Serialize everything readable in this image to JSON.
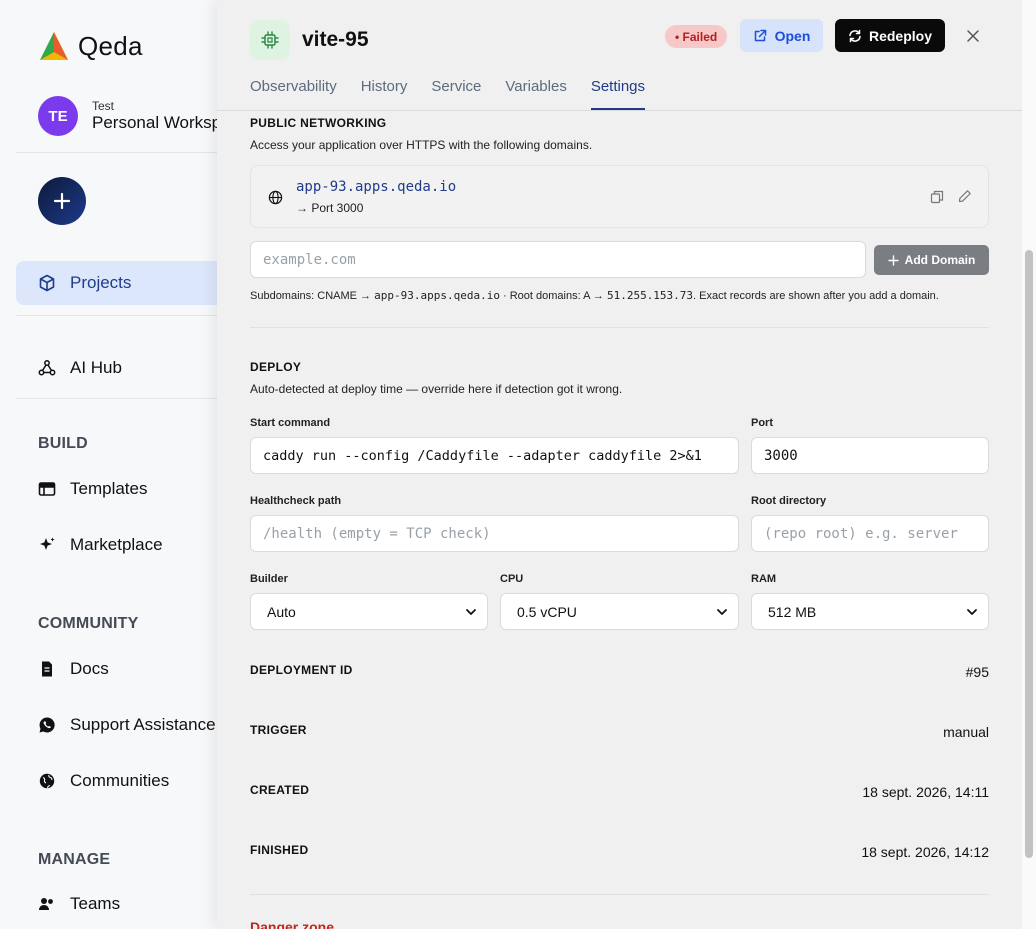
{
  "sidebar": {
    "brand": "Qeda",
    "workspace": {
      "initials": "TE",
      "label": "Test",
      "name": "Personal Workspace"
    },
    "items": {
      "projects": "Projects",
      "ai_hub": "AI Hub",
      "templates": "Templates",
      "marketplace": "Marketplace",
      "docs": "Docs",
      "support": "Support Assistance",
      "communities": "Communities",
      "teams": "Teams"
    },
    "sections": {
      "build": "BUILD",
      "community": "COMMUNITY",
      "manage": "MANAGE"
    }
  },
  "panel": {
    "title": "vite-95",
    "status": "• Failed",
    "open_label": "Open",
    "redeploy_label": "Redeploy",
    "tabs": [
      "Observability",
      "History",
      "Service",
      "Variables",
      "Settings"
    ],
    "active_tab": "Settings",
    "networking": {
      "heading": "PUBLIC NETWORKING",
      "description": "Access your application over HTTPS with the following domains.",
      "domain": "app-93.apps.qeda.io",
      "port_text": "→ Port 3000",
      "input_placeholder": "example.com",
      "add_label": "Add Domain",
      "note_prefix": "Subdomains: CNAME → ",
      "note_cname": "app-93.apps.qeda.io",
      "note_mid": " · Root domains: A → ",
      "note_ip": "51.255.153.73",
      "note_suffix": ". Exact records are shown after you add a domain."
    },
    "deploy": {
      "heading": "DEPLOY",
      "description": "Auto-detected at deploy time — override here if detection got it wrong.",
      "start_command_label": "Start command",
      "start_command": "caddy run --config /Caddyfile --adapter caddyfile 2>&1",
      "port_label": "Port",
      "port": "3000",
      "healthcheck_label": "Healthcheck path",
      "healthcheck_placeholder": "/health (empty = TCP check)",
      "root_label": "Root directory",
      "root_placeholder": "(repo root) e.g. server",
      "builder_label": "Builder",
      "builder": "Auto",
      "cpu_label": "CPU",
      "cpu": "0.5 vCPU",
      "ram_label": "RAM",
      "ram": "512 MB"
    },
    "details": {
      "deployment_id_label": "DEPLOYMENT ID",
      "deployment_id": "#95",
      "trigger_label": "TRIGGER",
      "trigger": "manual",
      "created_label": "CREATED",
      "created": "18 sept. 2026, 14:11",
      "finished_label": "FINISHED",
      "finished": "18 sept. 2026, 14:12"
    },
    "danger_zone": "Danger zone"
  },
  "colors": {
    "accent": "#1f3b8a",
    "failed_bg": "#f6c8c8",
    "failed_text": "#b32020",
    "avatar": "#7c3aed",
    "danger": "#c0261f"
  }
}
